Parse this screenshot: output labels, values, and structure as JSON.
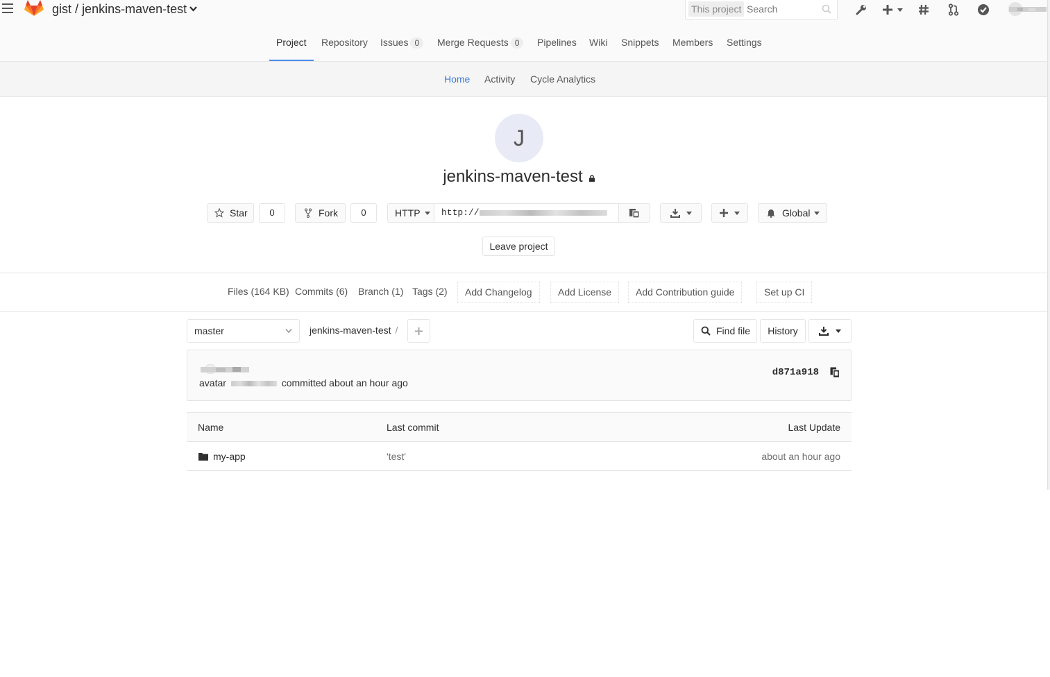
{
  "header": {
    "namespace": "gist",
    "separator": "/",
    "project": "jenkins-maven-test",
    "search_scope": "This project",
    "search_placeholder": "Search"
  },
  "nav_main": {
    "tabs": [
      {
        "label": "Project"
      },
      {
        "label": "Repository"
      },
      {
        "label": "Issues",
        "count": "0"
      },
      {
        "label": "Merge Requests",
        "count": "0"
      },
      {
        "label": "Pipelines"
      },
      {
        "label": "Wiki"
      },
      {
        "label": "Snippets"
      },
      {
        "label": "Members"
      },
      {
        "label": "Settings"
      }
    ]
  },
  "nav_sub": {
    "tabs": [
      {
        "label": "Home"
      },
      {
        "label": "Activity"
      },
      {
        "label": "Cycle Analytics"
      }
    ]
  },
  "project": {
    "avatar_letter": "J",
    "name": "jenkins-maven-test",
    "star_label": "Star",
    "star_count": "0",
    "fork_label": "Fork",
    "fork_count": "0",
    "protocol": "HTTP",
    "clone_prefix": "http://",
    "notification_label": "Global",
    "leave_label": "Leave project"
  },
  "stats": {
    "files": "Files (164 KB)",
    "commits": "Commits (6)",
    "branch": "Branch (1)",
    "tags": "Tags (2)",
    "add_changelog": "Add Changelog",
    "add_license": "Add License",
    "add_contribution": "Add Contribution guide",
    "setup_ci": "Set up CI"
  },
  "tree": {
    "branch": "master",
    "path": "jenkins-maven-test",
    "path_sep": "/",
    "find_file": "Find file",
    "history": "History"
  },
  "commit": {
    "avatar_alt": "avatar",
    "meta_text": "committed about an hour ago",
    "sha": "d871a918"
  },
  "table": {
    "headers": {
      "name": "Name",
      "last_commit": "Last commit",
      "last_update": "Last Update"
    },
    "rows": [
      {
        "name": "my-app",
        "commit": "'test'",
        "updated": "about an hour ago"
      }
    ]
  },
  "colors": {
    "accent": "#4a8bee",
    "link_active": "#3a7bd5",
    "border": "#e5e5e5"
  }
}
